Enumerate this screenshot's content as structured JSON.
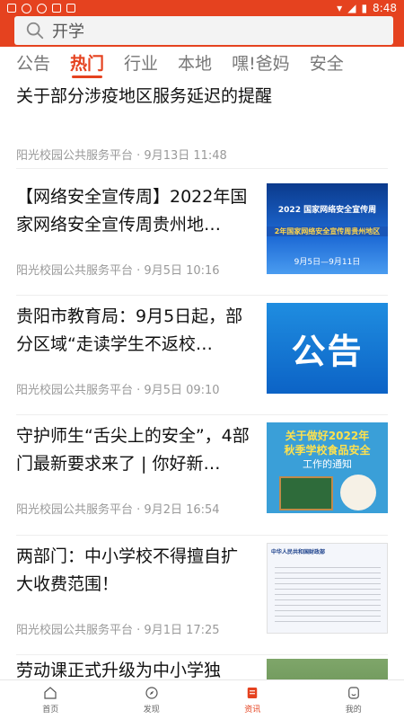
{
  "status": {
    "time": "8:48"
  },
  "search": {
    "placeholder": "开学"
  },
  "tabs": [
    {
      "label": "公告"
    },
    {
      "label": "热门"
    },
    {
      "label": "行业"
    },
    {
      "label": "本地"
    },
    {
      "label": "嘿!爸妈"
    },
    {
      "label": "安全"
    }
  ],
  "feed": [
    {
      "title": "关于部分涉疫地区服务延迟的提醒",
      "source": "阳光校园公共服务平台",
      "date": "9月13日 11:48"
    },
    {
      "title": "【网络安全宣传周】2022年国家网络安全宣传周贵州地…",
      "source": "阳光校园公共服务平台",
      "date": "9月5日 10:16",
      "thumb_text": {
        "line1": "2022 国家网络安全宣传周",
        "line2": "2年国家网络安全宣传周贵州地区",
        "line3": "9月5日—9月11日"
      }
    },
    {
      "title": "贵阳市教育局：9月5日起，部分区域“走读学生不返校…",
      "source": "阳光校园公共服务平台",
      "date": "9月5日 09:10",
      "thumb_text": {
        "line1": "公告"
      }
    },
    {
      "title": "守护师生“舌尖上的安全”，4部门最新要求来了 | 你好新…",
      "source": "阳光校园公共服务平台",
      "date": "9月2日 16:54",
      "thumb_text": {
        "line1": "关于做好2022年",
        "line2": "秋季学校食品安全",
        "line3": "工作的通知"
      }
    },
    {
      "title": "两部门：中小学校不得擅自扩大收费范围！",
      "source": "阳光校园公共服务平台",
      "date": "9月1日 17:25",
      "thumb_text": {
        "line1": "中华人民共和国财政部"
      }
    },
    {
      "title": "劳动课正式升级为中小学独"
    }
  ],
  "nav": [
    {
      "label": "首页"
    },
    {
      "label": "发现"
    },
    {
      "label": "资讯"
    },
    {
      "label": "我的"
    }
  ],
  "colors": {
    "accent": "#e5421f",
    "meta": "#999999",
    "text": "#111111"
  }
}
